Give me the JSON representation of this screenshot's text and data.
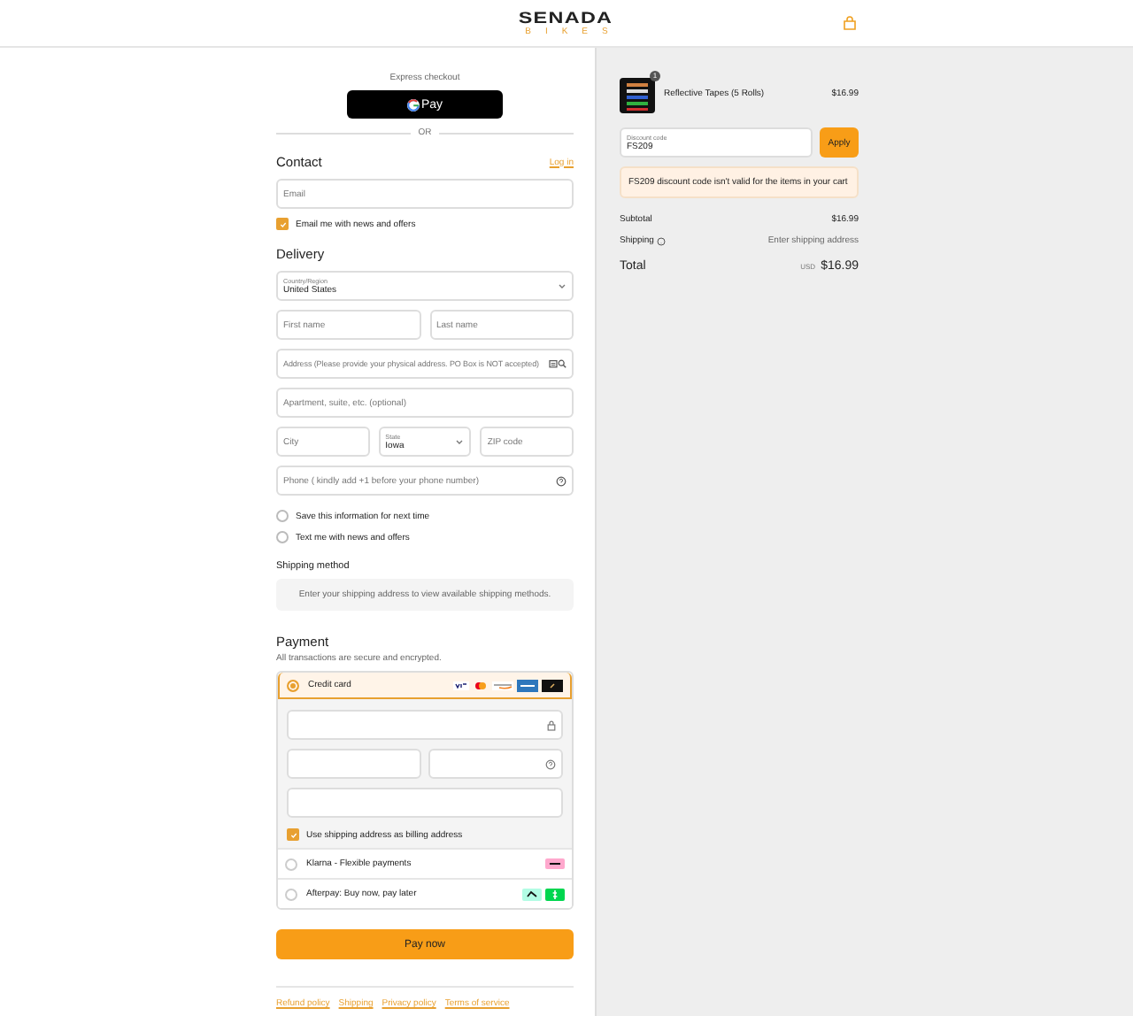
{
  "header": {
    "brand": "SENADA",
    "sub": "BIKES"
  },
  "express": {
    "label": "Express checkout",
    "button_text": "Pay",
    "divider": "OR"
  },
  "contact": {
    "title": "Contact",
    "login": "Log in",
    "email": {
      "placeholder": "Email"
    },
    "newsletter": {
      "label": "Email me with news and offers",
      "checked": true
    }
  },
  "delivery": {
    "title": "Delivery",
    "groups": [
      {
        "fields": [
          {
            "kind": "select",
            "label": "Country/Region",
            "value": "United States"
          }
        ]
      },
      {
        "fields": [
          {
            "kind": "text",
            "placeholder": "First name"
          },
          {
            "kind": "text",
            "placeholder": "Last name"
          }
        ]
      },
      {
        "fields": [
          {
            "kind": "address",
            "placeholder": "Address (Please provide your physical address. PO Box is NOT accepted)"
          }
        ]
      },
      {
        "fields": [
          {
            "kind": "text",
            "placeholder": "Apartment, suite, etc. (optional)"
          }
        ]
      },
      {
        "fields": [
          {
            "kind": "text",
            "placeholder": "City"
          },
          {
            "kind": "select",
            "label": "State",
            "value": "Iowa"
          },
          {
            "kind": "text",
            "placeholder": "ZIP code"
          }
        ]
      },
      {
        "fields": [
          {
            "kind": "phone",
            "placeholder": "Phone ( kindly add +1 before your phone number)"
          }
        ]
      }
    ],
    "options": [
      {
        "label": "Save this information for next time",
        "checked": false
      },
      {
        "label": "Text me with news and offers",
        "checked": false
      }
    ]
  },
  "shipping_method": {
    "title": "Shipping method",
    "message": "Enter your shipping address to view available shipping methods."
  },
  "payment": {
    "title": "Payment",
    "subtitle": "All transactions are secure and encrypted.",
    "billing_same": {
      "label": "Use shipping address as billing address",
      "checked": true
    },
    "methods": [
      {
        "kind": "card",
        "label": "Credit card",
        "selected": true
      },
      {
        "kind": "klarna",
        "label": "Klarna - Flexible payments",
        "selected": false
      },
      {
        "kind": "afterpay",
        "label": "Afterpay: Buy now, pay later",
        "selected": false
      }
    ],
    "pay_button": "Pay now"
  },
  "footer_links": [
    "Refund policy",
    "Shipping",
    "Privacy policy",
    "Terms of service"
  ],
  "summary": {
    "items": [
      {
        "name": "Reflective Tapes (5 Rolls)",
        "price": "$16.99",
        "quantity": "1"
      }
    ],
    "discount": {
      "label": "Discount code",
      "value": "FS209"
    },
    "apply": "Apply",
    "error": "FS209 discount code isn't valid for the items in your cart",
    "subtotal": {
      "label": "Subtotal",
      "value": "$16.99"
    },
    "shipping": {
      "label": "Shipping",
      "value": "Enter shipping address"
    },
    "total": {
      "label": "Total",
      "currency": "USD",
      "value": "$16.99"
    }
  }
}
